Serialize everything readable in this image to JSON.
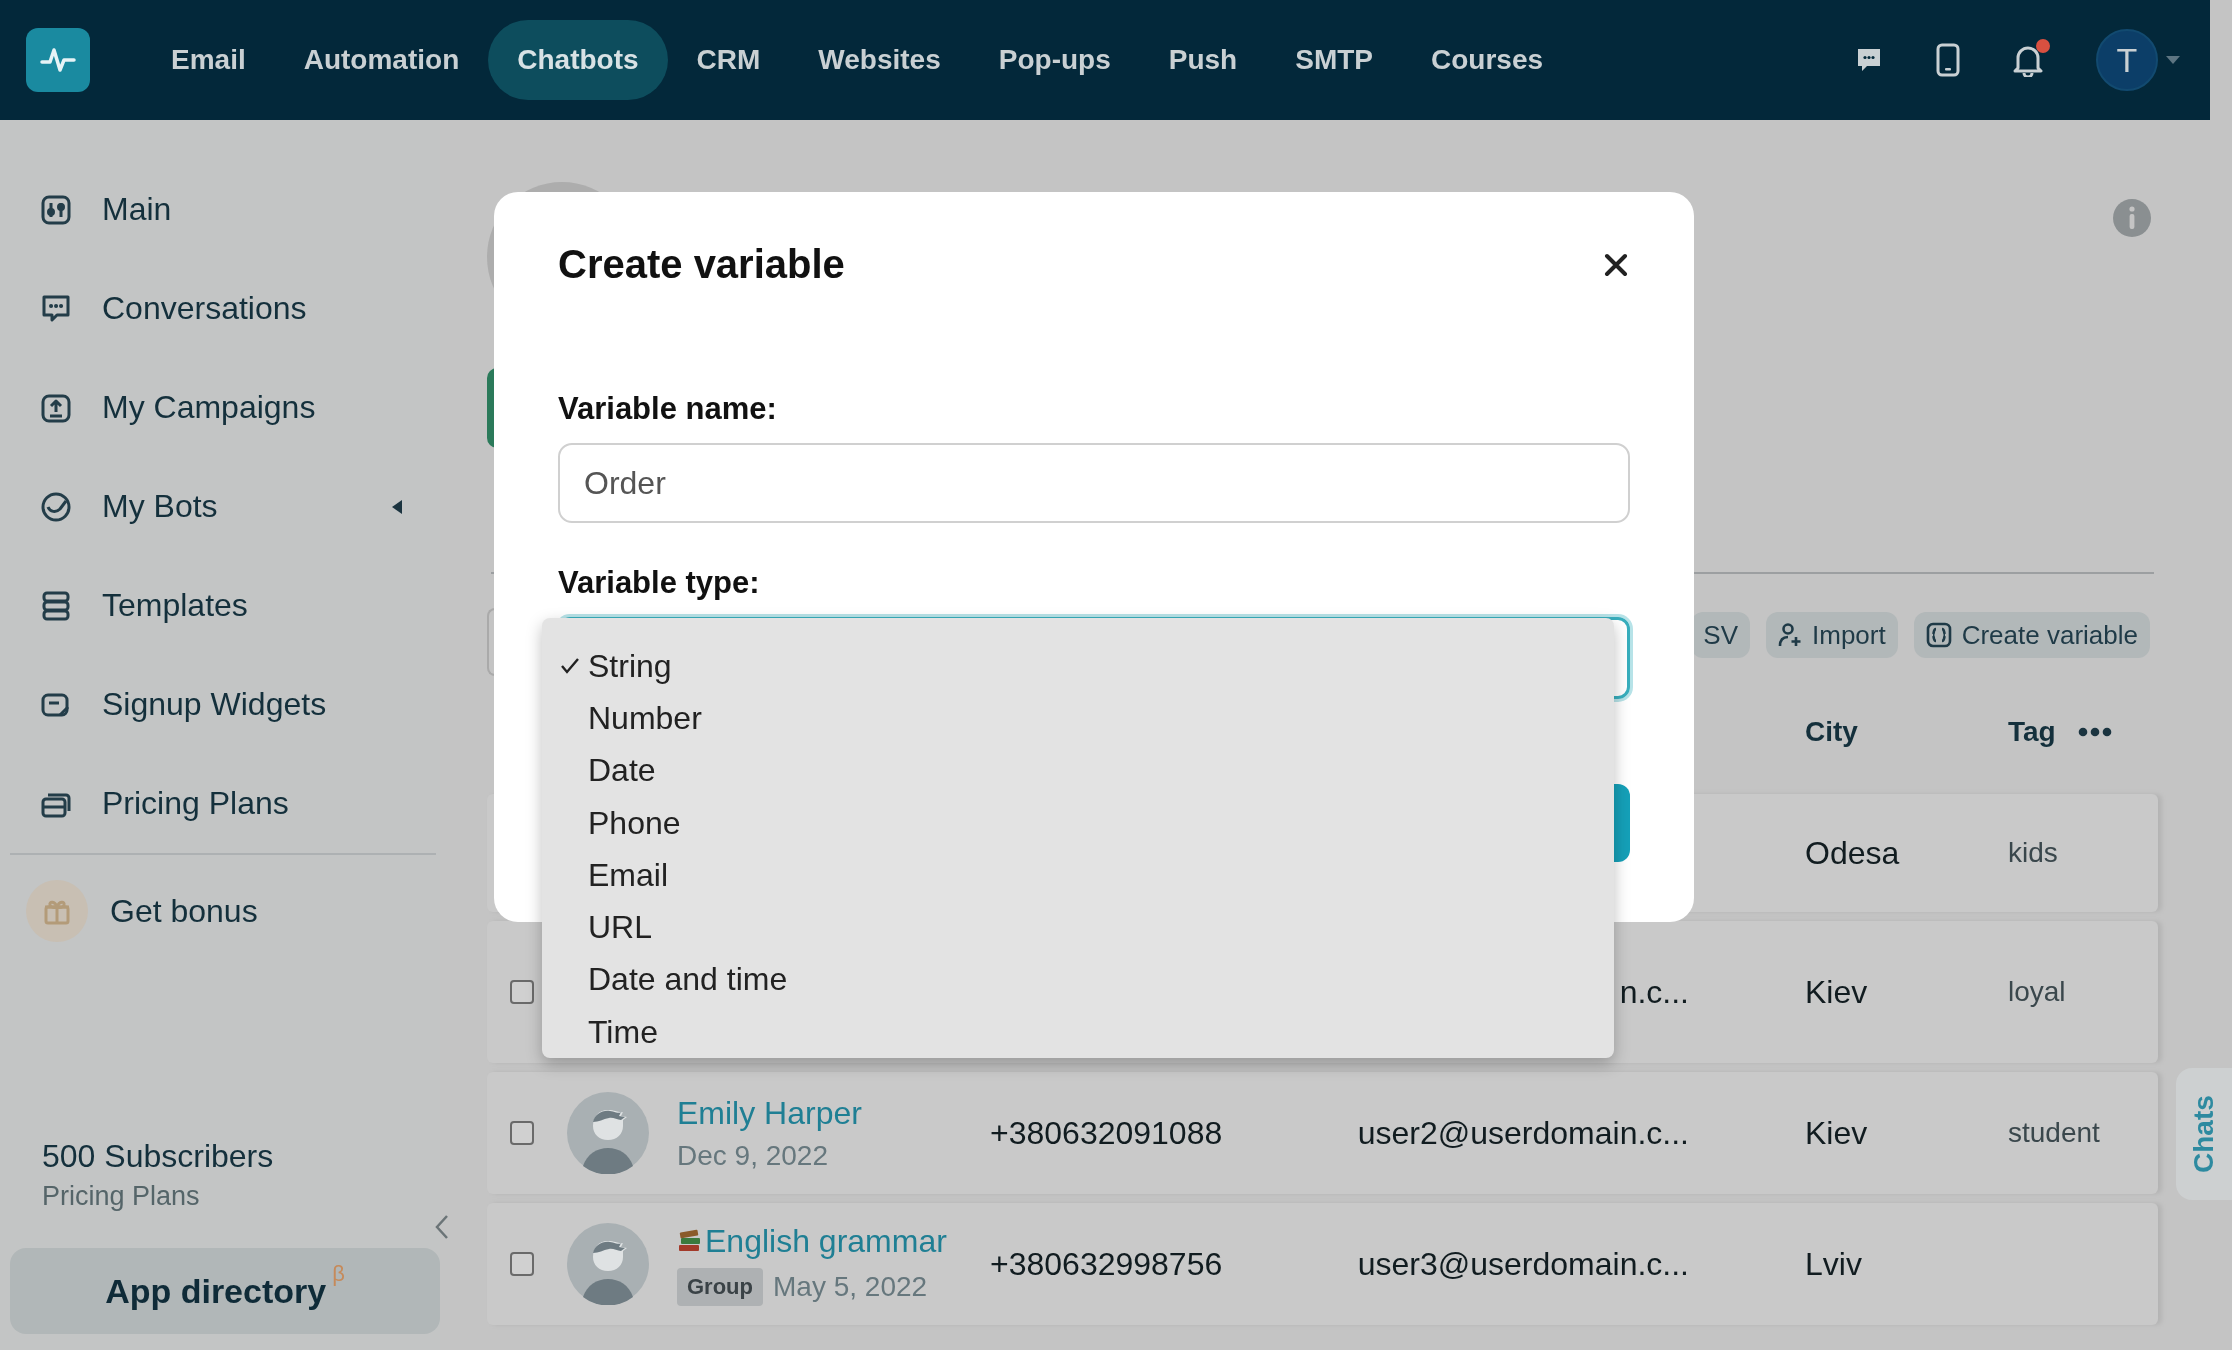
{
  "top_nav": {
    "items": [
      {
        "label": "Email",
        "selected": false
      },
      {
        "label": "Automation",
        "selected": false
      },
      {
        "label": "Chatbots",
        "selected": true
      },
      {
        "label": "CRM",
        "selected": false
      },
      {
        "label": "Websites",
        "selected": false
      },
      {
        "label": "Pop-ups",
        "selected": false
      },
      {
        "label": "Push",
        "selected": false
      },
      {
        "label": "SMTP",
        "selected": false
      },
      {
        "label": "Courses",
        "selected": false
      }
    ],
    "notifications": {
      "unread": true
    },
    "account": {
      "initial": "T"
    }
  },
  "sidebar": {
    "items": [
      {
        "label": "Main",
        "expandable": false
      },
      {
        "label": "Conversations",
        "expandable": false
      },
      {
        "label": "My Campaigns",
        "expandable": false
      },
      {
        "label": "My Bots",
        "expandable": true
      },
      {
        "label": "Templates",
        "expandable": false
      },
      {
        "label": "Signup Widgets",
        "expandable": false
      },
      {
        "label": "Pricing Plans",
        "expandable": false
      }
    ],
    "bonus": {
      "label": "Get bonus"
    },
    "plan": {
      "subscribers": "500 Subscribers",
      "link": "Pricing Plans"
    },
    "app_directory": {
      "label": "App directory",
      "badge": "β"
    }
  },
  "toolbar": {
    "buttons": [
      {
        "label": "SV"
      },
      {
        "label": "Import"
      },
      {
        "label": "Create variable"
      }
    ]
  },
  "table": {
    "columns": [
      {
        "label": "City"
      },
      {
        "label": "Tag"
      }
    ],
    "rows": [
      {
        "city": "Odesa",
        "tag": "kids"
      },
      {
        "checked": false,
        "email": "n.c...",
        "city": "Kiev",
        "tag": "loyal"
      },
      {
        "checked": false,
        "kind": "person",
        "name": "Emily Harper",
        "date": "Dec 9, 2022",
        "phone": "+380632091088",
        "email": "user2@userdomain.c...",
        "city": "Kiev",
        "tag": "student"
      },
      {
        "checked": false,
        "kind": "group",
        "name": "English grammar",
        "badge": "Group",
        "date": "May 5, 2022",
        "phone": "+380632998756",
        "email": "user3@userdomain.c...",
        "city": "Lviv"
      }
    ]
  },
  "modal": {
    "title": "Create variable",
    "name_field": {
      "label": "Variable name:",
      "value": "Order"
    },
    "type_field": {
      "label": "Variable type:"
    },
    "type_options": [
      {
        "label": "String",
        "selected": true
      },
      {
        "label": "Number",
        "selected": false
      },
      {
        "label": "Date",
        "selected": false
      },
      {
        "label": "Phone",
        "selected": false
      },
      {
        "label": "Email",
        "selected": false
      },
      {
        "label": "URL",
        "selected": false
      },
      {
        "label": "Date and time",
        "selected": false
      },
      {
        "label": "Time",
        "selected": false
      }
    ]
  },
  "side_tab": {
    "label": "Chats"
  }
}
